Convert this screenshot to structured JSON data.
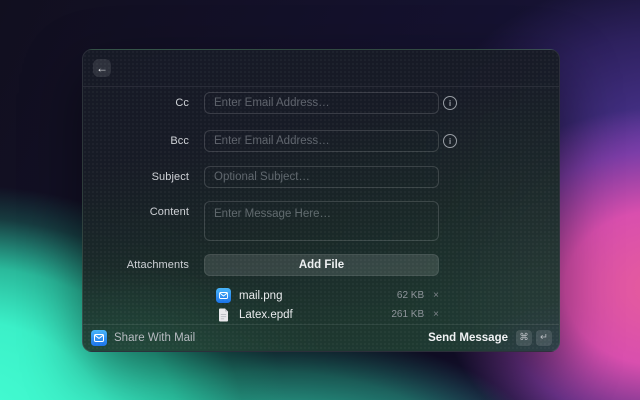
{
  "window": {
    "header": {
      "back_icon": "←"
    },
    "form": {
      "cc": {
        "label": "Cc",
        "placeholder": "Enter Email Address…",
        "value": ""
      },
      "bcc": {
        "label": "Bcc",
        "placeholder": "Enter Email Address…",
        "value": ""
      },
      "subject": {
        "label": "Subject",
        "placeholder": "Optional Subject…",
        "value": ""
      },
      "content": {
        "label": "Content",
        "placeholder": "Enter Message Here…",
        "value": ""
      },
      "info_icon_glyph": "i"
    },
    "attachments": {
      "label": "Attachments",
      "add_button_label": "Add File",
      "files": [
        {
          "name": "mail.png",
          "size": "62 KB",
          "icon": "mail-app-icon",
          "remove_glyph": "×"
        },
        {
          "name": "Latex.epdf",
          "size": "261 KB",
          "icon": "document-icon",
          "remove_glyph": "×"
        }
      ]
    },
    "footer": {
      "app_name": "Share With Mail",
      "action_label": "Send Message",
      "shortcut_keys": [
        "⌘",
        "↵"
      ]
    }
  },
  "colors": {
    "background_navy": "#141126",
    "background_mint": "#3ff0c9",
    "background_magenta": "#d94fae",
    "background_purple": "#5b3ea8",
    "mail_icon_blue": "#1a72e8",
    "panel_green_tint": "#1f3e33"
  }
}
